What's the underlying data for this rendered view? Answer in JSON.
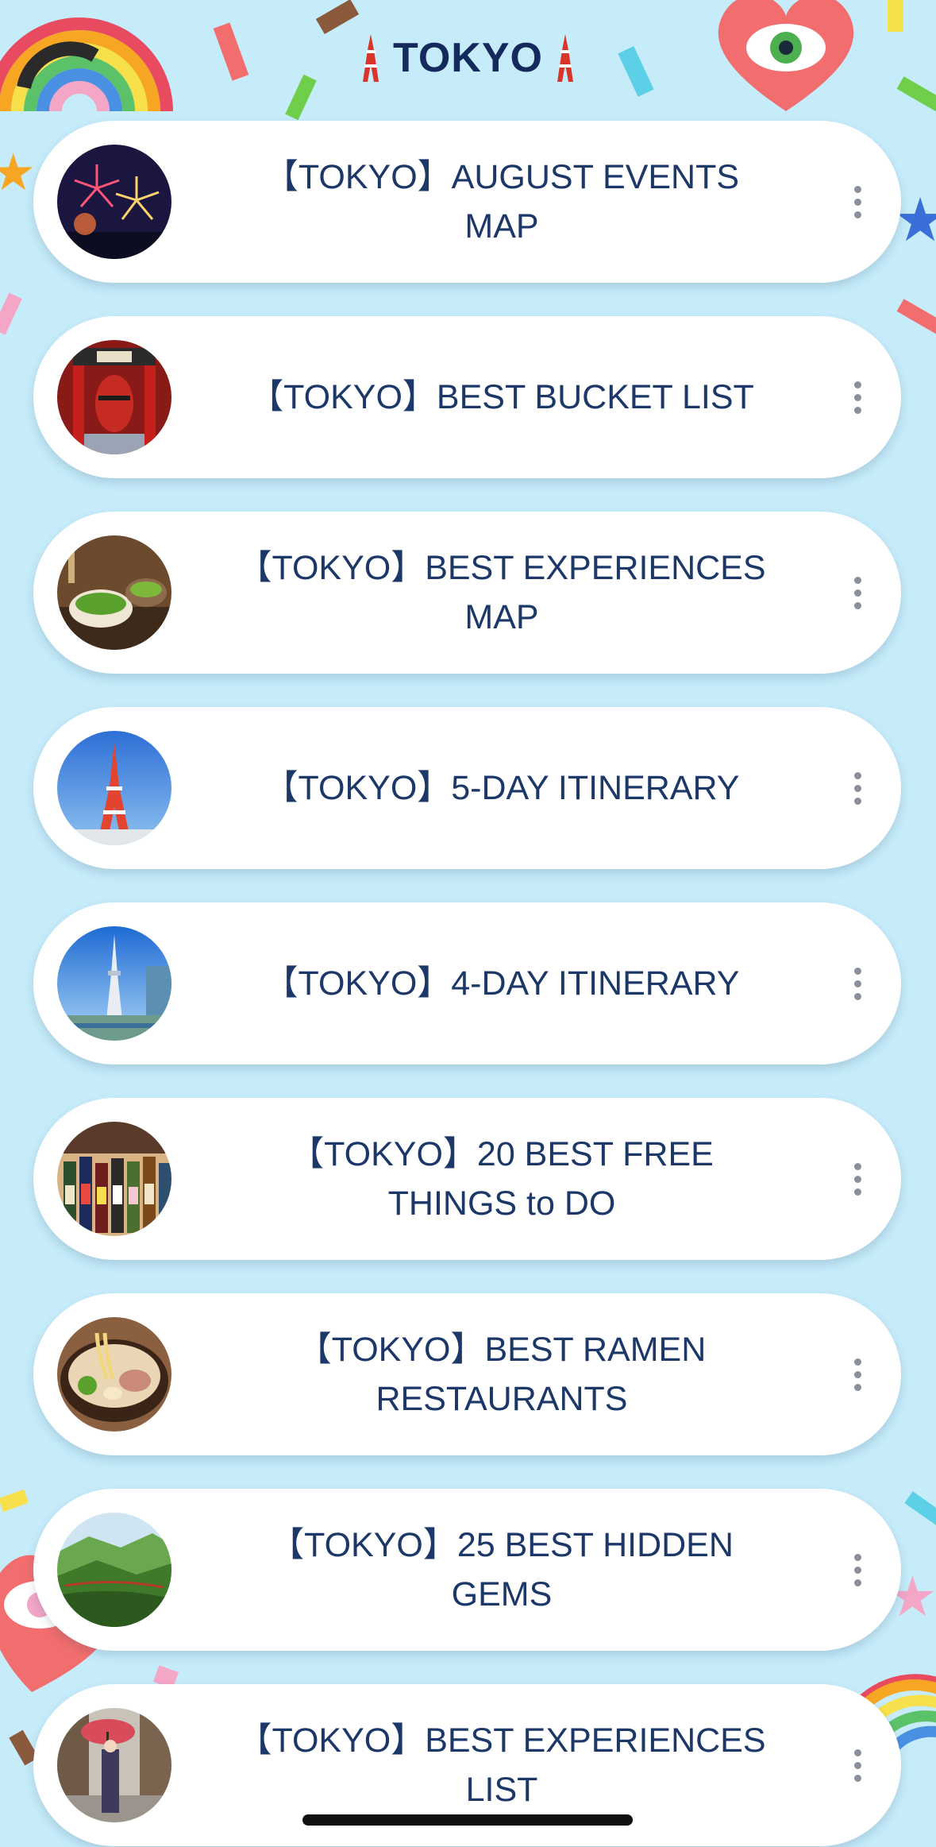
{
  "header": {
    "title": "TOKYO",
    "icon": "tokyo-tower-icon"
  },
  "items": [
    {
      "label": "【TOKYO】AUGUST EVENTS\nMAP",
      "thumb": "fireworks"
    },
    {
      "label": "【TOKYO】BEST BUCKET LIST",
      "thumb": "temple-gate"
    },
    {
      "label": "【TOKYO】BEST EXPERIENCES\nMAP",
      "thumb": "matcha"
    },
    {
      "label": "【TOKYO】5-DAY ITINERARY",
      "thumb": "tokyo-tower"
    },
    {
      "label": "【TOKYO】4-DAY ITINERARY",
      "thumb": "skytree"
    },
    {
      "label": "【TOKYO】20 BEST FREE\nTHINGS to DO",
      "thumb": "sake-bottles"
    },
    {
      "label": "【TOKYO】BEST RAMEN\nRESTAURANTS",
      "thumb": "ramen"
    },
    {
      "label": "【TOKYO】25 BEST HIDDEN\nGEMS",
      "thumb": "forest-valley"
    },
    {
      "label": "【TOKYO】BEST EXPERIENCES\nLIST",
      "thumb": "kimono-street"
    }
  ],
  "colors": {
    "background": "#c6ecfa",
    "card": "#ffffff",
    "text": "#1c3868",
    "title": "#142a5c"
  }
}
